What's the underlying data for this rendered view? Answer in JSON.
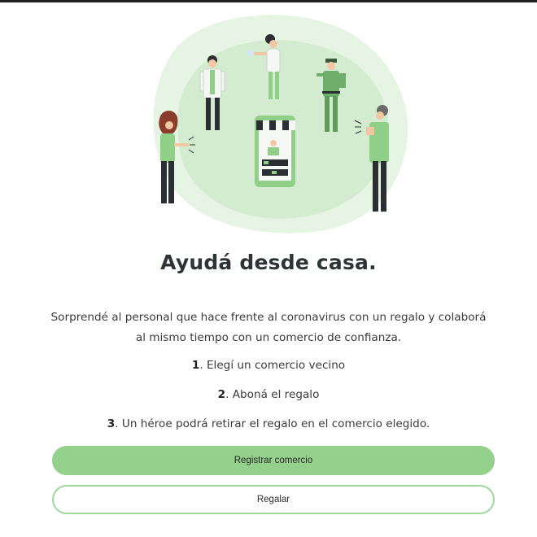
{
  "hero": {
    "colors": {
      "blob_light": "#e6f4e3",
      "blob": "#d3ebcf",
      "accent": "#8fcf87",
      "accent_dark": "#6fae6a",
      "dark": "#2b2f33"
    }
  },
  "content": {
    "title": "Ayudá desde casa.",
    "intro_line1": "Sorprendé al personal que hace frente al coronavirus con un regalo y colaborá",
    "intro_line2": "al mismo tiempo con un comercio de confianza.",
    "steps": [
      {
        "number": "1",
        "text": ". Elegí un comercio vecino"
      },
      {
        "number": "2",
        "text": ". Aboná el regalo"
      },
      {
        "number": "3",
        "text": ". Un héroe podrá retirar el regalo en el comercio elegido."
      }
    ]
  },
  "actions": {
    "register_label": "Registrar comercio",
    "gift_label": "Regalar"
  }
}
